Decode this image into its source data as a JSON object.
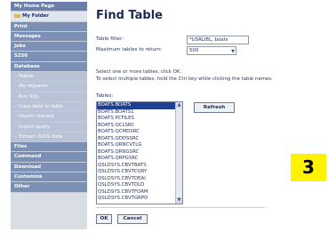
{
  "sidebar": {
    "items": [
      {
        "label": "My Home Page",
        "kind": "head"
      },
      {
        "label": "My Folder",
        "kind": "folder"
      },
      {
        "label": "Print",
        "kind": "top"
      },
      {
        "label": "Messages",
        "kind": "top"
      },
      {
        "label": "Jobs",
        "kind": "top"
      },
      {
        "label": "5250",
        "kind": "top"
      },
      {
        "label": "Database",
        "kind": "top"
      },
      {
        "label": "Tables",
        "kind": "sub"
      },
      {
        "label": "My requests",
        "kind": "sub"
      },
      {
        "label": "Run SQL",
        "kind": "sub"
      },
      {
        "label": "Copy data to table",
        "kind": "sub"
      },
      {
        "label": "Import request",
        "kind": "sub"
      },
      {
        "label": "Import query",
        "kind": "sub"
      },
      {
        "label": "Extract i5/OS data",
        "kind": "sub"
      },
      {
        "label": "Files",
        "kind": "top"
      },
      {
        "label": "Command",
        "kind": "top"
      },
      {
        "label": "Download",
        "kind": "top"
      },
      {
        "label": "Customize",
        "kind": "top"
      },
      {
        "label": "Other",
        "kind": "top"
      }
    ]
  },
  "main": {
    "title": "Find Table",
    "filter_label": "Table filter:",
    "filter_value": "*USRLIBL, boats",
    "max_label": "Maximum tables to return:",
    "max_value": "500",
    "instruction_1": "Select one or more tables, click OK.",
    "instruction_2": "To select multiple tables, hold the Ctrl key while clicking the table names.",
    "tables_label": "Tables:",
    "tables": [
      "BOATS.BOATS",
      "BOATS.BOATS1",
      "BOATS.PCFILES",
      "BOATS.QCLSRC",
      "BOATS.QCMDSRC",
      "BOATS.QDDSSRC",
      "BOATS.QRNCVTLG",
      "BOATS.QRNGSRC",
      "BOATS.QRPGSRC",
      "QSLDSYS.CBVTBATS",
      "QSLDSYS.CBVTCQRY",
      "QSLDSYS.CBVTDEAI",
      "QSLDSYS.CBVTDLD",
      "QSLDSYS.CBVTFORM",
      "QSLDSYS.CBVTGRPD"
    ],
    "refresh_label": "Refresh",
    "ok_label": "OK",
    "cancel_label": "Cancel"
  },
  "badge": {
    "text": "3",
    "color": "#fff200"
  }
}
